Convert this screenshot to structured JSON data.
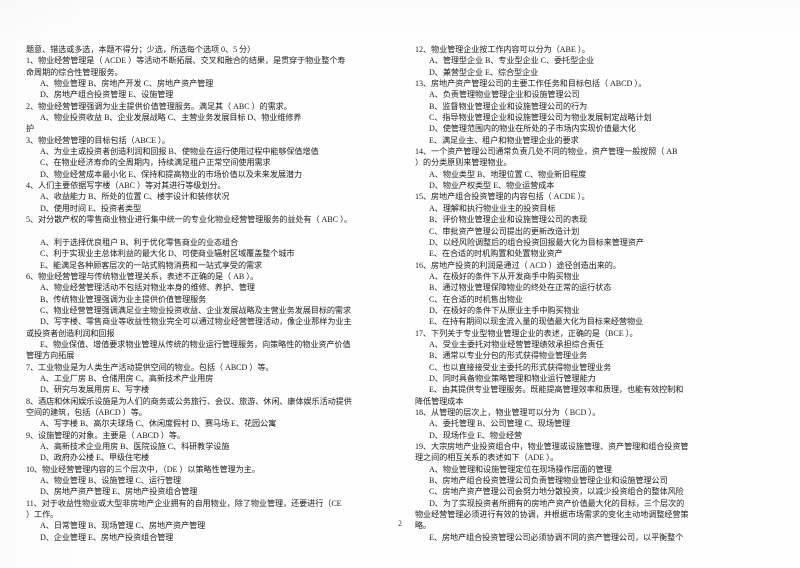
{
  "document": {
    "type": "exam-paper",
    "subject_hint": "物业经营管理",
    "page_number": "2"
  },
  "left_column": [
    {
      "kind": "stem",
      "text": "题意、错选或多选，本题不得分；少选，所选每个选项 0、5 分）"
    },
    {
      "kind": "stem",
      "text": "1、物业经营管理是（ ACDE     ）等活动不断拓展、交叉和融合的结果，是贯穿于物业整个寿"
    },
    {
      "kind": "cont",
      "text": "命周期的综合性管理服务。"
    },
    {
      "kind": "opt",
      "text": "A、物业管理      B、房地产开发      C、房地产资产管理"
    },
    {
      "kind": "opt",
      "text": "D、房地产组合投资管理      E、设施管理"
    },
    {
      "kind": "stem",
      "text": "2、物业经营管理强调为业主提供价值管理服务。满足其（   ABC    ）的需求。"
    },
    {
      "kind": "opt",
      "text": "A、物业投资收益          B、企业发展战略          C、主营业务发展目标       D、物业维修养"
    },
    {
      "kind": "cont",
      "text": "护"
    },
    {
      "kind": "stem",
      "text": "3、物业经营管理的目标包括（ABCE      ）。"
    },
    {
      "kind": "opt",
      "text": "A、为业主或投资者创造利润和回报          B、使物业在运行使用过程中能够保值增值"
    },
    {
      "kind": "opt",
      "text": "C、在物业经济寿命的全周期内，持续满足租户正常空间使用需求"
    },
    {
      "kind": "opt",
      "text": "D、物业经营成本最小化      E、保持和提高物业的市场价值以及未来发展潜力"
    },
    {
      "kind": "stem",
      "text": "4、人们主要依据写字楼（ABC      ）等对其进行等级划分。"
    },
    {
      "kind": "opt",
      "text": "A、收益能力      B、所处的位置      C、楼宇设计和装修状况"
    },
    {
      "kind": "opt",
      "text": "D、使用时间      E、投资者类型"
    },
    {
      "kind": "stem",
      "text": "5、对分散产权的零售商业物业进行集中统一的专业化物业经营管理服务的益处有（ ABC     ）。"
    },
    {
      "kind": "blank",
      "text": ""
    },
    {
      "kind": "opt",
      "text": "A、利于选择优良租户      B、利于优化零售商业的业态组合"
    },
    {
      "kind": "opt",
      "text": "C、利于实现业主总体利益的最大化      D、可使商业辐射区域覆盖整个城市"
    },
    {
      "kind": "opt",
      "text": "E、能满足各种顾客层次的一站式购物消费和一站式享受的需求"
    },
    {
      "kind": "stem",
      "text": "6、物业经营管理与传统物业管理关系，表述不正确的是（   AB    ）。"
    },
    {
      "kind": "opt",
      "text": "A、物业经营管理活动不包括对物业本身的维修、养护、管理"
    },
    {
      "kind": "opt",
      "text": "B、传统物业管理强调为业主提供价值管理服务"
    },
    {
      "kind": "opt",
      "text": "C、物业经营管理强调满足业主物业投资收益、企业发展战略及主营业务发展目标的需求"
    },
    {
      "kind": "opt",
      "text": "D、写字楼、零售商业等收益性物业完全可以通过物业经营管理活动，像企业那样为业主"
    },
    {
      "kind": "cont",
      "text": "或投资者创造利润和回报"
    },
    {
      "kind": "opt",
      "text": "E、物业保值、增值要求物业管理从传统的物业运行管理服务，向策略性的物业资产价值"
    },
    {
      "kind": "cont",
      "text": "管理方向拓展"
    },
    {
      "kind": "stem",
      "text": "7、工业物业是为人类生产活动提供空间的物业。包括（ ABCD     ）等。"
    },
    {
      "kind": "opt",
      "text": "A、工业厂房      B、仓储用房      C、高新技术产业用房"
    },
    {
      "kind": "opt",
      "text": "D、研究与发展用房      E、写字楼"
    },
    {
      "kind": "stem",
      "text": "8、酒店和休闲娱乐设施是为人们的商务或公务旅行、会议、旅游、休闲、康体娱乐活动提供"
    },
    {
      "kind": "cont",
      "text": "空间的建筑，包括（ABCD     ）等。"
    },
    {
      "kind": "opt",
      "text": "A、写字楼      B、高尔夫球场      C、休闲度假村       D、赛马场       E、花园公寓"
    },
    {
      "kind": "stem",
      "text": "9、设施管理的对象。主要是（ ABCD    ）等。"
    },
    {
      "kind": "opt",
      "text": "A、高新技术企业用房      B、医院设施      C、科研教学设施"
    },
    {
      "kind": "opt",
      "text": "D、政府办公楼             E、甲级住宅楼"
    },
    {
      "kind": "stem",
      "text": "10、物业经营管理内容的三个层次中，（DE      ）以策略性管理为主。"
    },
    {
      "kind": "opt",
      "text": "A、物业管理     B、设施管理      C、运行管理"
    },
    {
      "kind": "opt",
      "text": "D、房地产资产管理      E、房地产投资组合管理"
    },
    {
      "kind": "stem",
      "text": "11、对于收益性物业或大型非房地产企业拥有的自用物业，除了物业管理，还要进行（CE"
    },
    {
      "kind": "cont",
      "text": "）工作。"
    },
    {
      "kind": "opt",
      "text": "A、日常管理      B、现场管理      C、房地产资产管理"
    },
    {
      "kind": "opt",
      "text": "D、企业管理      E、房地产投资组合管理"
    }
  ],
  "right_column": [
    {
      "kind": "stem",
      "text": "12、物业管理企业按工作内容可以分为（ABE      ）。"
    },
    {
      "kind": "opt",
      "text": "A、管理型企业      B、专业型企业      C、委托型企业"
    },
    {
      "kind": "opt",
      "text": "D、兼营型企业      E、综合型企业"
    },
    {
      "kind": "stem",
      "text": "13、房地产资产管理公司的主要工作任务和目标包括（   ABCD      ）。"
    },
    {
      "kind": "opt",
      "text": "A、负责管理物业管理企业和设施管理公司"
    },
    {
      "kind": "opt",
      "text": "B、监督物业管理企业和设施管理公司的行为"
    },
    {
      "kind": "opt",
      "text": "C、指导物业管理企业和设施管理公司为物业发展制定战略计划"
    },
    {
      "kind": "opt",
      "text": "D、使管理范围内的物业在所处的子市场内实现价值最大化"
    },
    {
      "kind": "opt",
      "text": "E、满足业主、租户和物业管理企业的要求"
    },
    {
      "kind": "stem",
      "text": "14、一个资产管理公司通常负责几处不同的物业，资产管理一般按照（      AB"
    },
    {
      "kind": "cont",
      "text": "）的分类原则来管理物业。"
    },
    {
      "kind": "opt",
      "text": "A、物业类型      B、地理位置      C、物业新旧程度"
    },
    {
      "kind": "opt",
      "text": "D、物业产权类型       E、物业运营成本"
    },
    {
      "kind": "stem",
      "text": "15、房地产组合投资管理的内容包括（ ACDE      ）。"
    },
    {
      "kind": "opt",
      "text": "A、理解和执行物业业主的投资目标"
    },
    {
      "kind": "opt",
      "text": "B、评价物业管理企业和设施管理公司的表现"
    },
    {
      "kind": "opt",
      "text": "C、审批资产管理公司提出的更新改造计划"
    },
    {
      "kind": "opt",
      "text": "D、以经风险调整后的组合投资回报最大化为目标来管理资产"
    },
    {
      "kind": "opt",
      "text": "E、在合适的时机购置和处置物业资产"
    },
    {
      "kind": "stem",
      "text": "16、房地产投资的利润是通过（ ACD      ）途径创造出来的。"
    },
    {
      "kind": "opt",
      "text": "A、在极好的条件下从开发商手中购买物业"
    },
    {
      "kind": "opt",
      "text": "B、通过物业管理保障物业的终处在正常的运行状态"
    },
    {
      "kind": "opt",
      "text": "C、在合适的时机售出物业"
    },
    {
      "kind": "opt",
      "text": "D、在极好的条件下从原业主手中购买物业"
    },
    {
      "kind": "opt",
      "text": "E、在持有期间以现金流入量的现值最大化为目标来经营物业"
    },
    {
      "kind": "stem",
      "text": "17、下列关于专业型物业管理企业的表述，正确的是（BCE       ）。"
    },
    {
      "kind": "opt",
      "text": "A、受业主委托对物业经营管理绩效承担综合责任"
    },
    {
      "kind": "opt",
      "text": "B、通常以专业分包的形式获得物业管理业务"
    },
    {
      "kind": "opt",
      "text": "C、也以直接接受业主委托的形式获得物业管理业务"
    },
    {
      "kind": "opt",
      "text": "D、同时具备物业策略管理和物业运行管理能力"
    },
    {
      "kind": "opt",
      "text": "E、由其提供专业管理服务。既能提高管理效率和质理，也能有效控制和"
    },
    {
      "kind": "cont",
      "text": "降低管理成本"
    },
    {
      "kind": "stem",
      "text": "18、从管理的层次上，物业管理可以分为（ BCD     ）。"
    },
    {
      "kind": "opt",
      "text": "A、委托管理      B、公司管理      C、现场管理"
    },
    {
      "kind": "opt",
      "text": "D、现场作业      E、物业经营"
    },
    {
      "kind": "stem",
      "text": "19、大宗房地产业投资组合中，物业管理或设施管理、资产管理和组合投资管"
    },
    {
      "kind": "cont",
      "text": "理之间的相互关系的表述如下（ADE      ）。"
    },
    {
      "kind": "opt",
      "text": "A、物业管理和设施管理定位在现场操作层面的管理"
    },
    {
      "kind": "opt",
      "text": "B、房地产组合投资管理公司负责管理物业管理企业和设施管理公司"
    },
    {
      "kind": "opt",
      "text": "C、房地产资产管理公司会努力地分散投资，以减少投资组合的整体风险"
    },
    {
      "kind": "opt",
      "text": "D、为了实现投资者所拥有的房地产资产价值最大化的目标，三个层次的"
    },
    {
      "kind": "cont",
      "text": "物业经营管理必须进行有效的协调，并根据市场需求的变化主动地调整经营策"
    },
    {
      "kind": "cont",
      "text": "略。"
    },
    {
      "kind": "opt",
      "text": "E、房地产组合投资管理公司必须协调不同的资产管理公司，以平衡整个"
    }
  ]
}
